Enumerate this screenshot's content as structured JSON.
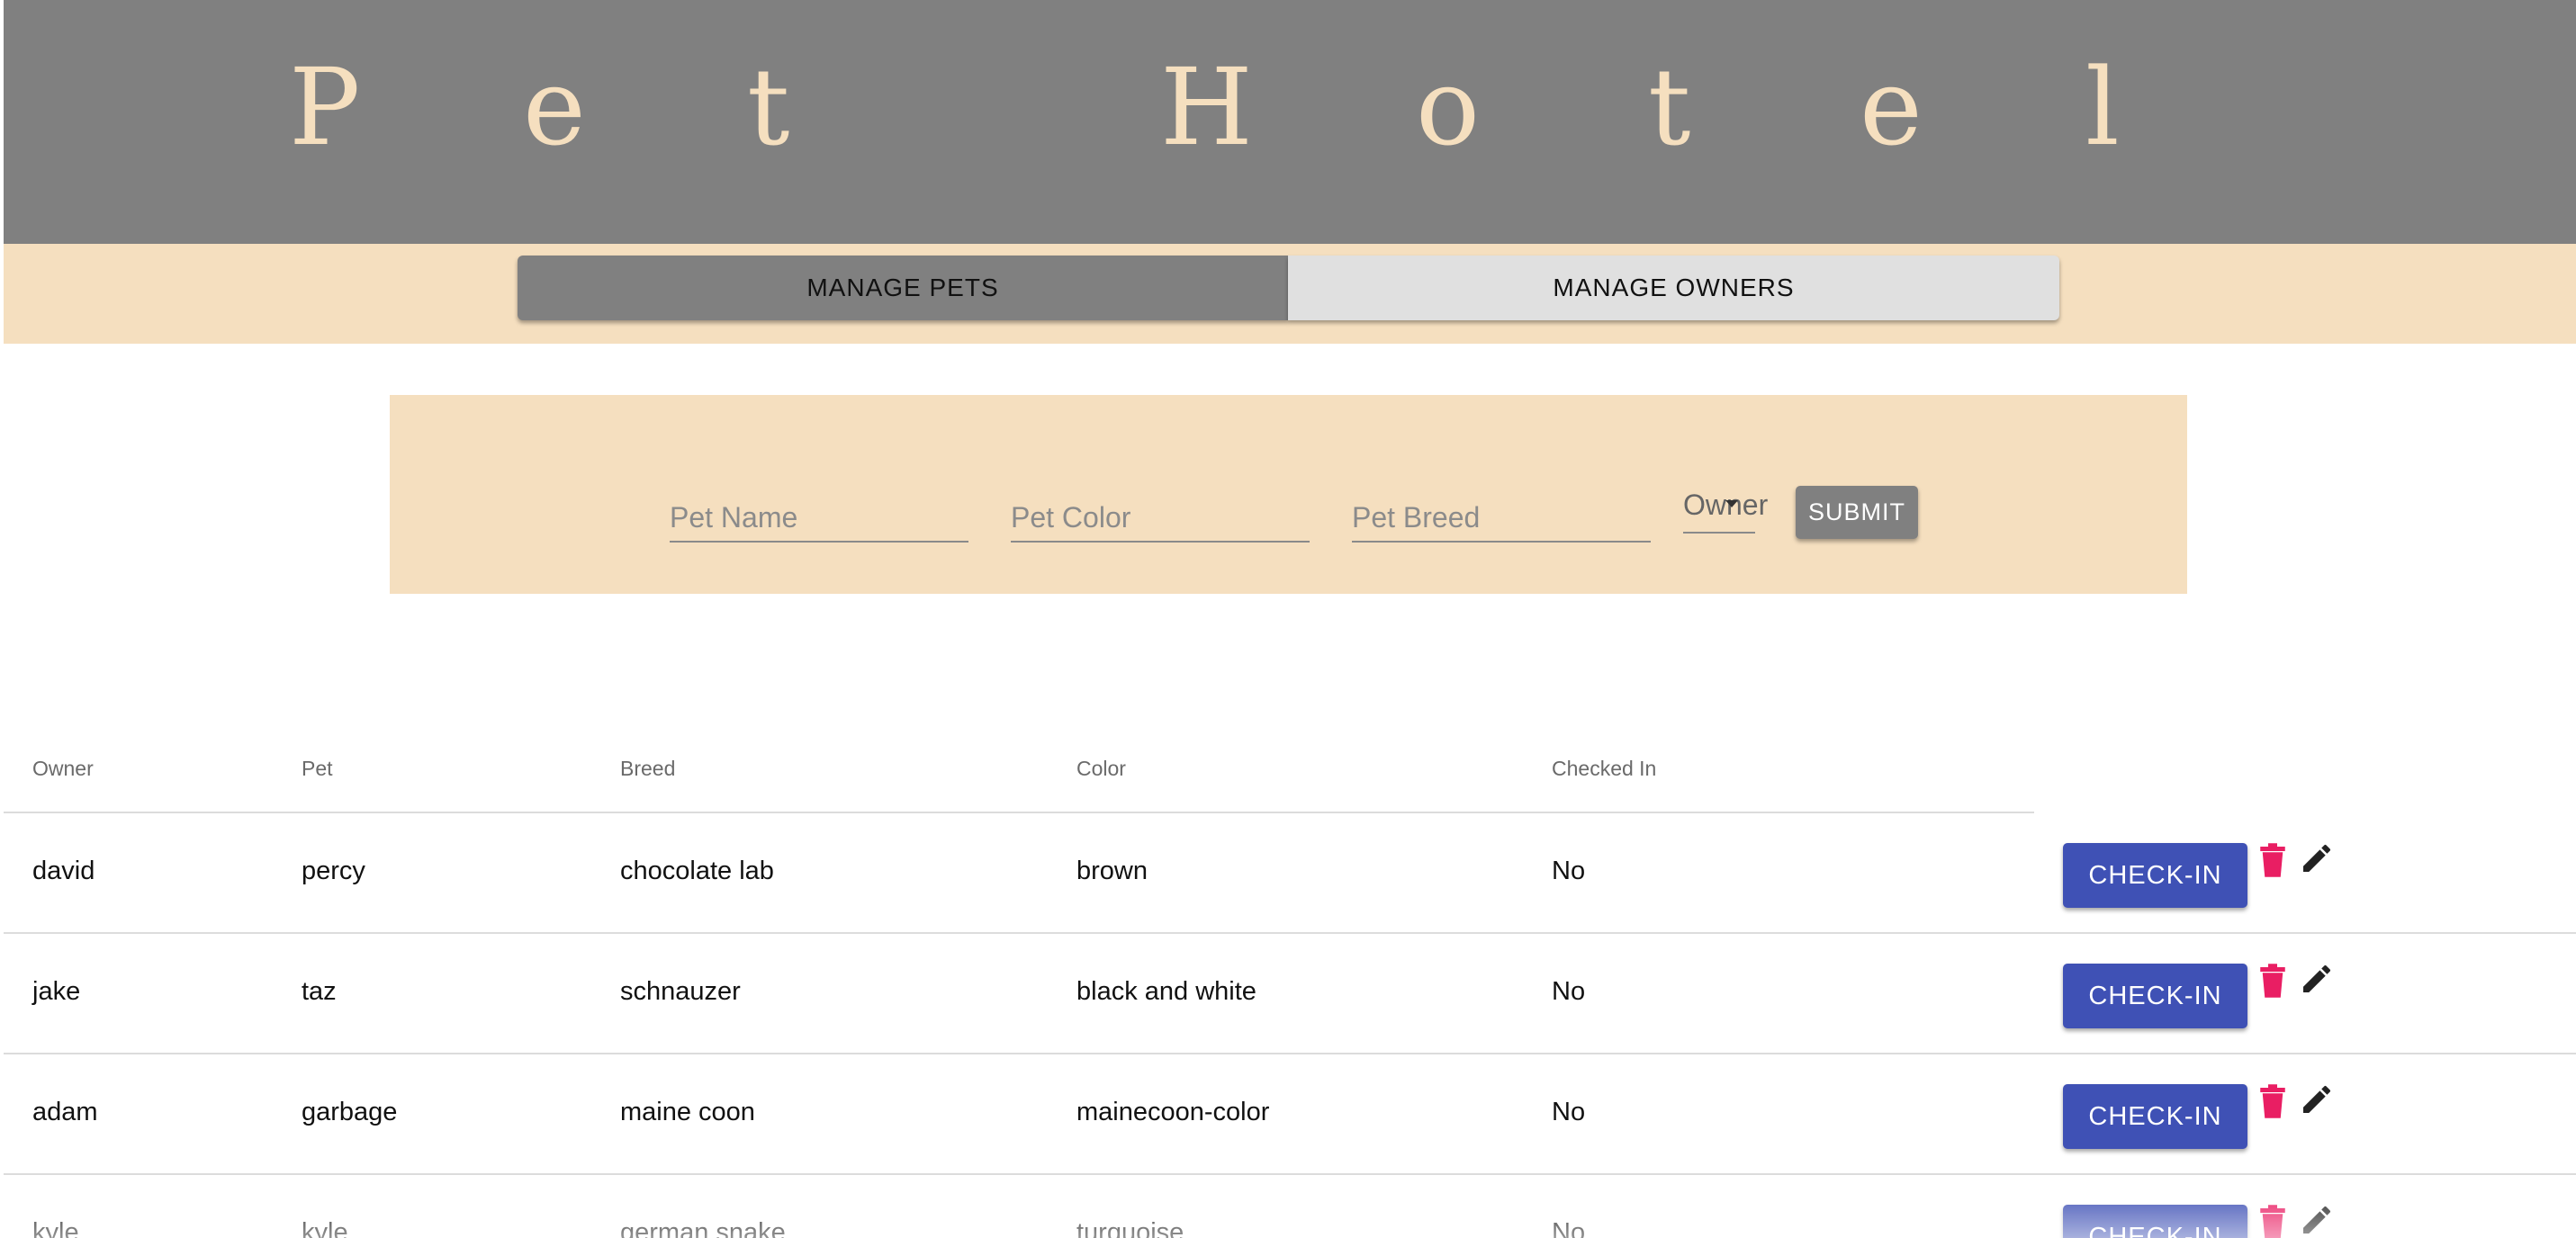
{
  "app": {
    "title_letters": [
      "P",
      "e",
      "t",
      "H",
      "o",
      "t",
      "e",
      "l"
    ]
  },
  "tabs": {
    "manage_pets": "MANAGE PETS",
    "manage_owners": "MANAGE OWNERS",
    "active": "MANAGE PETS"
  },
  "form": {
    "pet_name_placeholder": "Pet Name",
    "pet_color_placeholder": "Pet Color",
    "pet_breed_placeholder": "Pet Breed",
    "owner_label": "Owner",
    "submit_label": "SUBMIT"
  },
  "table": {
    "headers": [
      "Owner",
      "Pet",
      "Breed",
      "Color",
      "Checked In"
    ],
    "rows": [
      {
        "owner": "david",
        "pet": "percy",
        "breed": "chocolate lab",
        "color": "brown",
        "checked_in": "No",
        "action": "CHECK-IN"
      },
      {
        "owner": "jake",
        "pet": "taz",
        "breed": "schnauzer",
        "color": "black and white",
        "checked_in": "No",
        "action": "CHECK-IN"
      },
      {
        "owner": "adam",
        "pet": "garbage",
        "breed": "maine coon",
        "color": "mainecoon-color",
        "checked_in": "No",
        "action": "CHECK-IN"
      },
      {
        "owner": "kyle",
        "pet": "kyle",
        "breed": "german snake",
        "color": "turquoise",
        "checked_in": "No",
        "action": "CHECK-IN"
      }
    ]
  },
  "colors": {
    "header_bg": "#808080",
    "accent_cream": "#f5dfbf",
    "checkin_button": "#3f51b5",
    "delete_icon": "#e91e63",
    "edit_icon": "#222222"
  },
  "icons": {
    "delete": "trash-icon",
    "edit": "pencil-icon",
    "owner_dropdown": "caret-down-icon"
  }
}
